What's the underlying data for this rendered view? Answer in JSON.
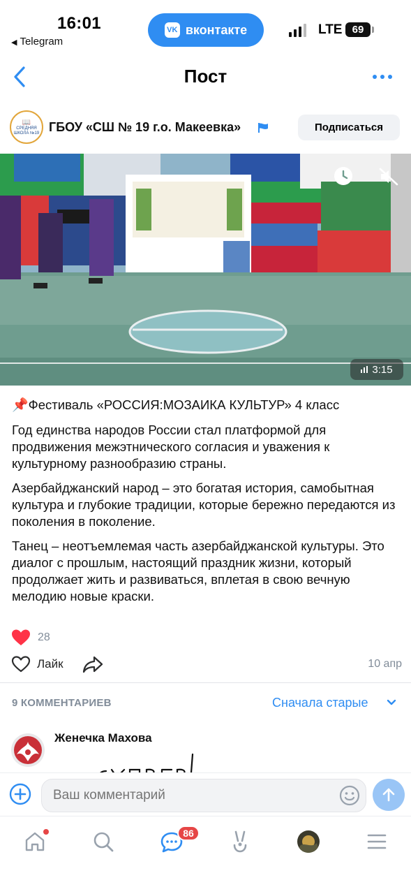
{
  "status_bar": {
    "time": "16:01",
    "back_app": "Telegram",
    "app_pill": "вконтакте",
    "app_pill_logo": "VK",
    "network": "LTE",
    "battery": "69"
  },
  "nav": {
    "title": "Пост",
    "back_icon": "chevron-left-icon",
    "more_icon": "more-dots-icon"
  },
  "post": {
    "group_name": "ГБОУ «СШ № 19 г.о. Макеевка»",
    "avatar_text": "СРЕДНЯЯ ШКОЛА №19",
    "subscribe_label": "Подписаться",
    "video_duration": "3:15",
    "title": "Фестиваль «РОССИЯ:МОЗАИКА КУЛЬТУР» 4 класс",
    "paragraphs": [
      "Год единства народов России стал платформой для продвижения межэтнического согласия и уважения к культурному разнообразию страны.",
      "Азербайджанский народ – это богатая история, самобытная культура и глубокие традиции, которые бережно передаются из поколения в поколение.",
      "Танец – неотъемлемая часть азербайджанской культуры. Это диалог с прошлым, настоящий праздник жизни, который продолжает жить и развиваться, вплетая  в свою вечную мелодию новые краски."
    ],
    "reactions_count": "28",
    "like_label": "Лайк",
    "date": "10 апр"
  },
  "comments": {
    "count_label": "9 КОММЕНТАРИЕВ",
    "sort_label": "Сначала старые",
    "items": [
      {
        "author": "Женечка Махова",
        "text": "СУПЕР!"
      }
    ]
  },
  "input": {
    "placeholder": "Ваш комментарий"
  },
  "tab_bar": {
    "messages_badge": "86"
  },
  "colors": {
    "accent": "#2f8df2",
    "secondary_text": "#818c99",
    "badge": "#e64646",
    "reaction_heart": "#e64646"
  }
}
